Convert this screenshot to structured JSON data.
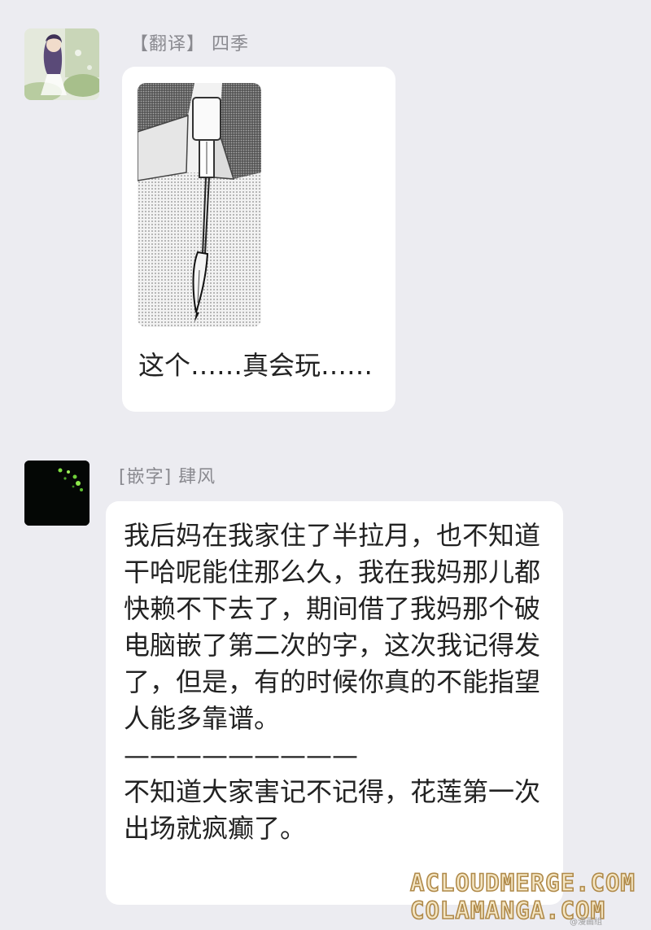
{
  "messages": [
    {
      "sender": "【翻译】 四季",
      "avatar_icon": "illustrated-character-avatar",
      "image_icon": "fountain-pen-manga-panel",
      "text": "这个……真会玩……"
    },
    {
      "sender": "[嵌字] 肆风",
      "avatar_icon": "dark-green-sparkle-avatar",
      "text": "我后妈在我家住了半拉月，也不知道干哈呢能住那么久，我在我妈那儿都快赖不下去了，期间借了我妈那个破电脑嵌了第二次的字，这次我记得发了，但是，有的时候你真的不能指望人能多靠谱。\n—————————\n不知道大家害记不记得，花莲第一次出场就疯癫了。"
    }
  ],
  "watermark": {
    "line1": "ACLOUDMERGE.COM",
    "line2": "COLAMANGA.COM",
    "small": "@漫画组"
  }
}
